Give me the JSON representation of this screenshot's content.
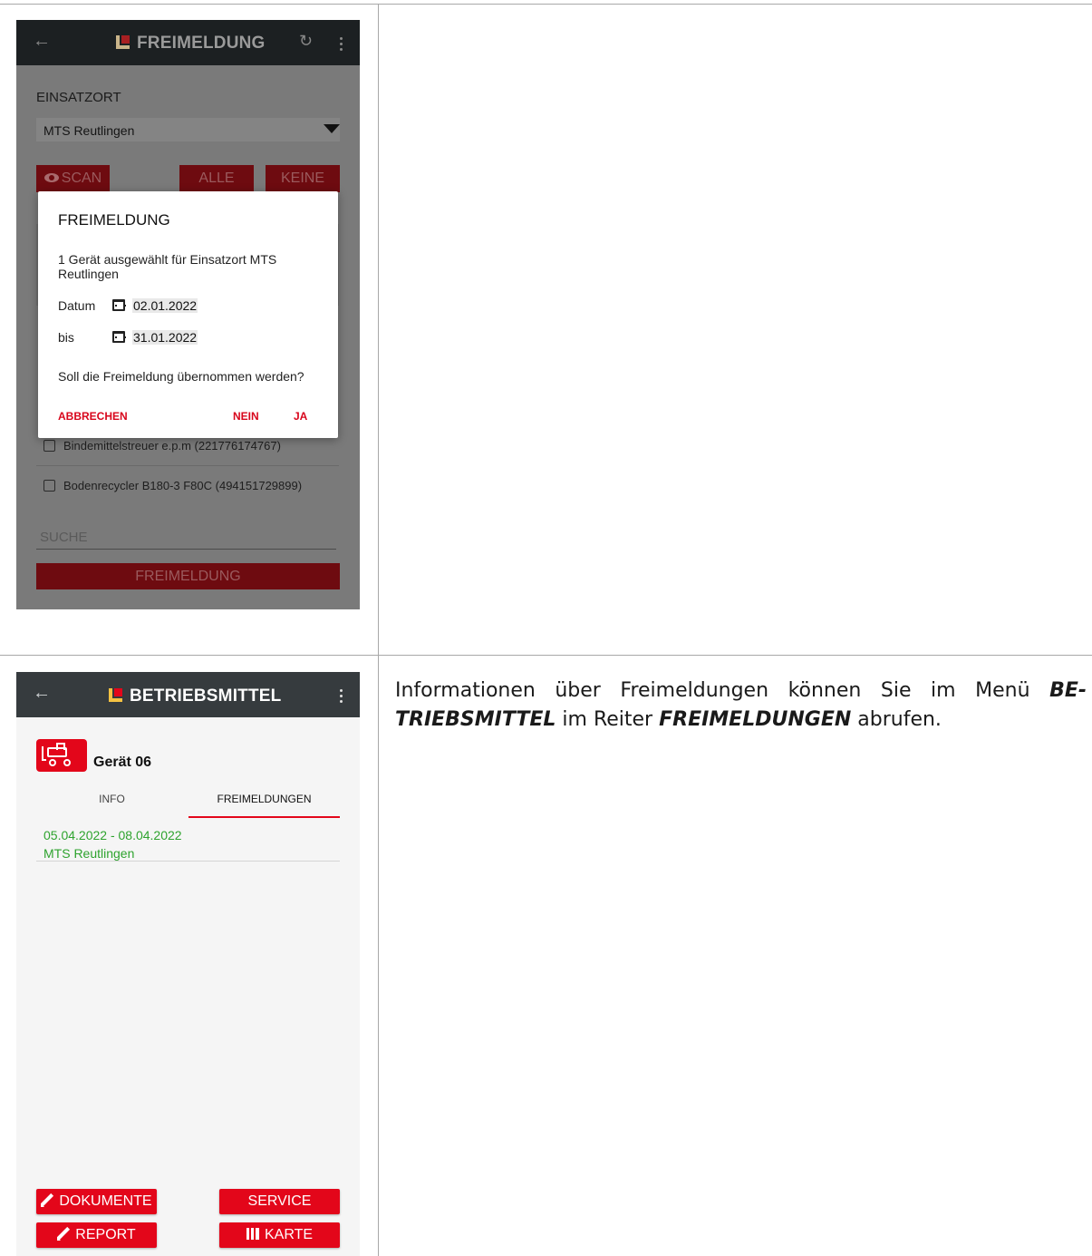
{
  "screen1": {
    "title": "FREIMELDUNG",
    "field_label": "EINSATZORT",
    "location_value": "MTS Reutlingen",
    "buttons": {
      "scan": "SCAN",
      "all": "ALLE",
      "none": "KEINE"
    },
    "list": [
      {
        "label": "Bindemittelstreuer e.p.m  (221776174767)"
      },
      {
        "label": "Bodenrecycler B180-3 F80C (494151729899)"
      }
    ],
    "search_placeholder": "SUCHE",
    "bottom_button": "FREIMELDUNG",
    "dialog": {
      "title": "FREIMELDUNG",
      "message": "1 Gerät ausgewählt für Einsatzort MTS Reutlingen",
      "date_label": "Datum",
      "date_value": "02.01.2022",
      "until_label": "bis",
      "until_value": "31.01.2022",
      "question": "Soll die Freimeldung übernommen werden?",
      "cancel": "ABBRECHEN",
      "no": "NEIN",
      "yes": "JA"
    }
  },
  "screen2": {
    "title": "BETRIEBSMITTEL",
    "device_name": "Gerät 06",
    "tabs": [
      {
        "label": "INFO"
      },
      {
        "label": "FREIMELDUNGEN"
      }
    ],
    "entries": [
      {
        "dates": "05.04.2022 - 08.04.2022",
        "location": "MTS Reutlingen"
      }
    ],
    "buttons": {
      "documents": "DOKUMENTE",
      "service": "SERVICE",
      "report": "REPORT",
      "map": "KARTE"
    }
  },
  "description": {
    "part1": "Informationen über Freimeldungen können Sie im Menü ",
    "menu": "BE-TRIEBSMITTEL",
    "part2": " im Reiter ",
    "tab": "FREIMELDUNGEN",
    "part3": " abrufen."
  },
  "colors": {
    "accent_red": "#e3061a",
    "entry_green": "#2ea32e",
    "appbar_dark": "#363b3e"
  }
}
